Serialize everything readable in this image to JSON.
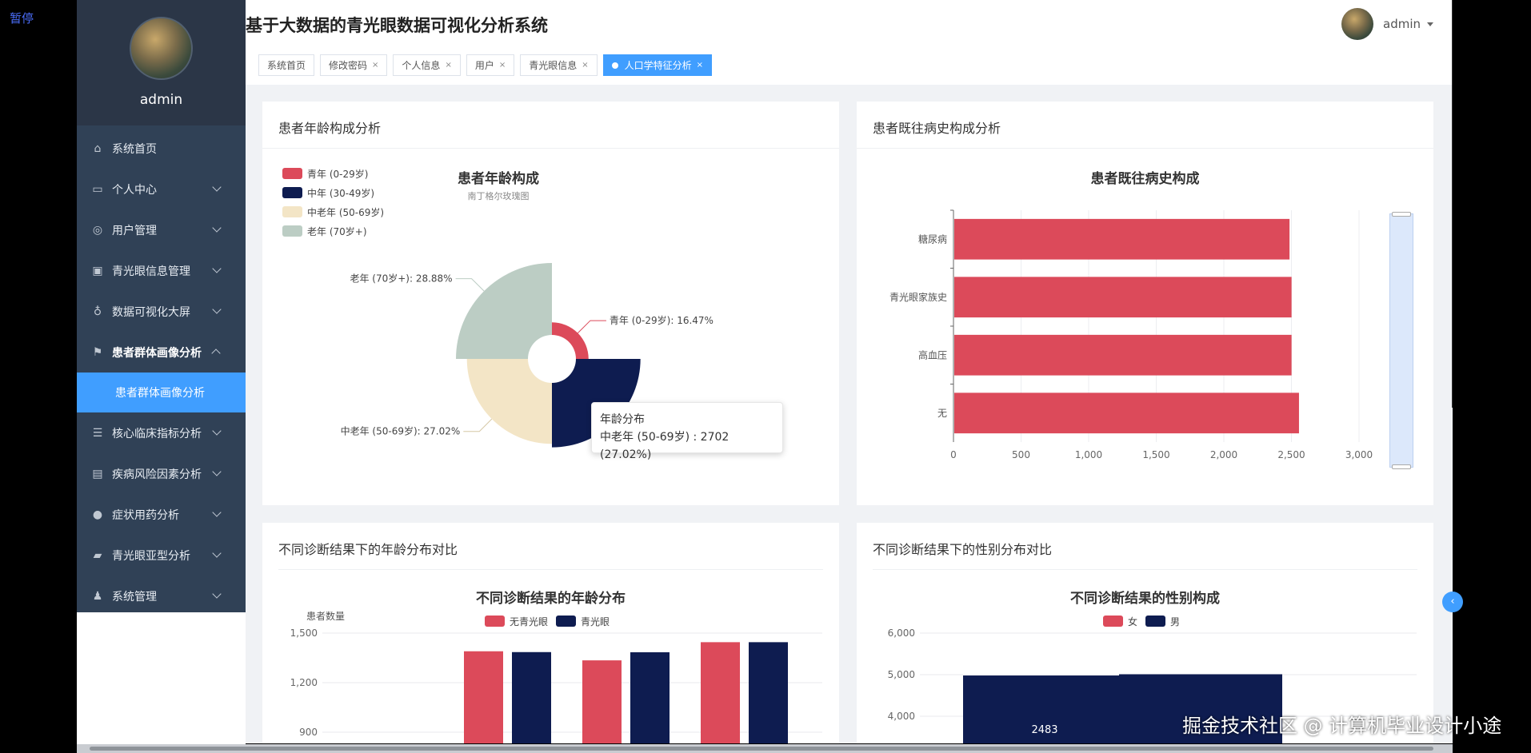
{
  "overlay": {
    "pause_label": "暂停",
    "watermark": "掘金技术社区 @ 计算机毕业设计小途"
  },
  "header": {
    "title": "基于大数据的青光眼数据可视化分析系统",
    "user": "admin"
  },
  "sidebar": {
    "user": "admin",
    "items": [
      {
        "label": "系统首页",
        "icon": "home-icon"
      },
      {
        "label": "个人中心",
        "icon": "card-icon"
      },
      {
        "label": "用户管理",
        "icon": "compass-icon"
      },
      {
        "label": "青光眼信息管理",
        "icon": "clipboard-icon"
      },
      {
        "label": "数据可视化大屏",
        "icon": "microphone-icon"
      },
      {
        "label": "患者群体画像分析",
        "icon": "flag-icon"
      },
      {
        "label": "患者群体画像分析",
        "icon": ""
      },
      {
        "label": "核心临床指标分析",
        "icon": "list-icon"
      },
      {
        "label": "疾病风险因素分析",
        "icon": "id-card-icon"
      },
      {
        "label": "症状用药分析",
        "icon": "user-icon"
      },
      {
        "label": "青光眼亚型分析",
        "icon": "wallet-icon"
      },
      {
        "label": "系统管理",
        "icon": "person-icon"
      }
    ]
  },
  "tabs": [
    {
      "label": "系统首页"
    },
    {
      "label": "修改密码"
    },
    {
      "label": "个人信息"
    },
    {
      "label": "用户"
    },
    {
      "label": "青光眼信息"
    },
    {
      "label": "人口学特征分析"
    }
  ],
  "colors": {
    "red": "#dc4a5a",
    "navy": "#0e1c50",
    "cream": "#f3e5c6",
    "sage": "#bccdc4",
    "blue": "#409eff"
  },
  "cards": {
    "age": {
      "title": "患者年龄构成分析",
      "tooltip_title": "年龄分布",
      "tooltip_body": "中老年 (50-69岁) : 2702 (27.02%)"
    },
    "history": {
      "title": "患者既往病史构成分析"
    },
    "diag_age": {
      "title": "不同诊断结果下的年龄分布对比"
    },
    "diag_gender": {
      "title": "不同诊断结果下的性别分布对比"
    }
  },
  "chart_data": [
    {
      "type": "pie",
      "title": "患者年龄构成",
      "subtitle": "南丁格尔玫瑰图",
      "series": [
        {
          "name": "青年 (0-29岁)",
          "value": 16.47,
          "color": "#dc4a5a",
          "label": "青年 (0-29岁): 16.47%"
        },
        {
          "name": "中年 (30-49岁)",
          "value": 27.63,
          "color": "#0e1c50",
          "label": ""
        },
        {
          "name": "中老年 (50-69岁)",
          "value": 27.02,
          "color": "#f3e5c6",
          "label": "中老年 (50-69岁): 27.02%"
        },
        {
          "name": "老年 (70岁+)",
          "value": 28.88,
          "color": "#bccdc4",
          "label": "老年 (70岁+): 28.88%"
        }
      ]
    },
    {
      "type": "bar",
      "orientation": "horizontal",
      "title": "患者既往病史构成",
      "categories": [
        "糖尿病",
        "青光眼家族史",
        "高血压",
        "无"
      ],
      "values": [
        2480,
        2495,
        2495,
        2550
      ],
      "xlim": [
        0,
        3000
      ],
      "xticks": [
        "0",
        "500",
        "1,000",
        "1,500",
        "2,000",
        "2,500",
        "3,000"
      ],
      "color": "#dc4a5a"
    },
    {
      "type": "bar",
      "title": "不同诊断结果的年龄分布",
      "ylabel": "患者数量",
      "yticks": [
        "1,500",
        "1,200",
        "900"
      ],
      "ylim": [
        900,
        1500
      ],
      "legend": [
        "无青光眼",
        "青光眼"
      ],
      "series": [
        {
          "name": "无青光眼",
          "values": [
            1390,
            1335,
            1445
          ],
          "color": "#dc4a5a"
        },
        {
          "name": "青光眼",
          "values": [
            1385,
            1384,
            1445
          ],
          "color": "#0e1c50"
        }
      ]
    },
    {
      "type": "bar",
      "title": "不同诊断结果的性别构成",
      "yticks": [
        "6,000",
        "5,000",
        "4,000"
      ],
      "ylim": [
        4000,
        6000
      ],
      "legend": [
        "女",
        "男"
      ],
      "series": [
        {
          "name": "男",
          "values": [
            4980,
            5010
          ],
          "color": "#0e1c50"
        }
      ],
      "data_labels": [
        "2483"
      ]
    }
  ]
}
